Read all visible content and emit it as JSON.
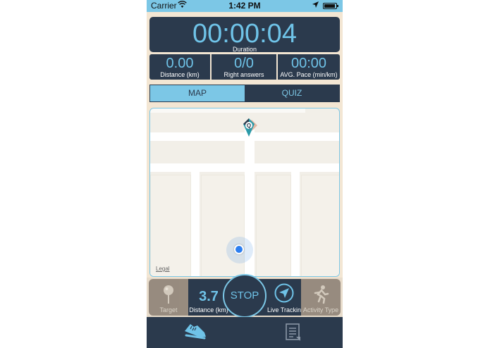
{
  "status_bar": {
    "carrier": "Carrier",
    "time": "1:42 PM"
  },
  "stats": {
    "duration_value": "00:00:04",
    "duration_label": "Duration",
    "distance_value": "0.00",
    "distance_label": "Distance (km)",
    "answers_value": "0/0",
    "answers_label": "Right answers",
    "pace_value": "00:00",
    "pace_label": "AVG. Pace (min/km)"
  },
  "tabs": {
    "map_label": "MAP",
    "quiz_label": "QUIZ",
    "active": "map"
  },
  "map": {
    "legal_label": "Legal",
    "marker_letter": "Q"
  },
  "controls": {
    "target_label": "Target",
    "distance_value": "3.7",
    "distance_label": "Distance (km)",
    "stop_label": "STOP",
    "live_tracking_label": "Live Tracking",
    "activity_type_label": "Activity Type"
  },
  "icons": {
    "wifi": "wifi-icon",
    "location": "location-arrow-icon",
    "battery": "battery-icon",
    "target": "pin-icon",
    "live_tracking": "navigation-compass-icon",
    "activity": "runner-icon",
    "tab_run": "running-shoe-icon",
    "tab_report": "report-list-icon"
  },
  "colors": {
    "primary_dark": "#2b3a4d",
    "accent": "#7cc7e6",
    "background": "#f3e6d3",
    "location_dot": "#2d7ff0",
    "marker": "#2b9aa8"
  }
}
